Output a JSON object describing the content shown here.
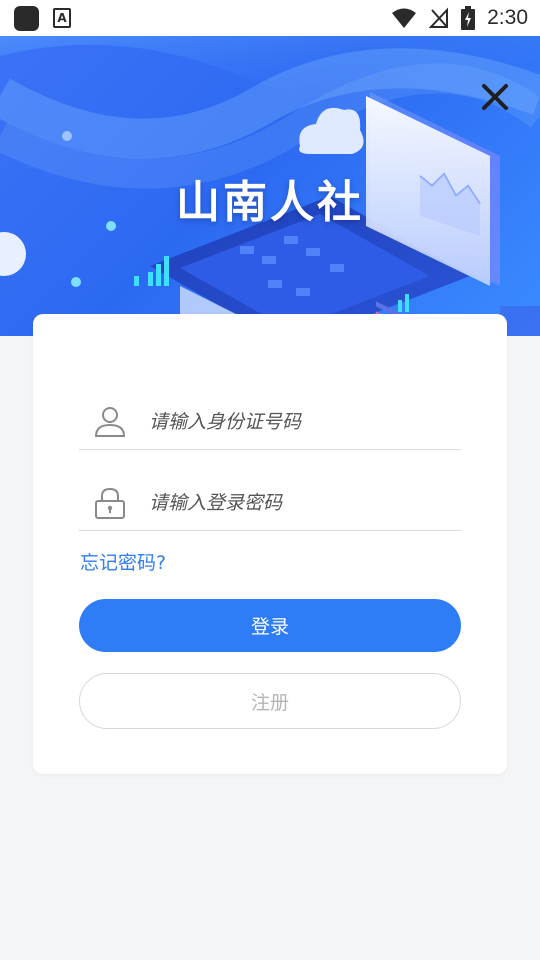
{
  "status_bar": {
    "time": "2:30",
    "icons": [
      "app-icon",
      "a-text-icon",
      "wifi-icon",
      "no-signal-icon",
      "battery-charging-icon"
    ]
  },
  "hero": {
    "title": "山南人社",
    "close_icon": "close-icon"
  },
  "form": {
    "id_field": {
      "placeholder": "请输入身份证号码",
      "value": "",
      "icon": "user-icon"
    },
    "password_field": {
      "placeholder": "请输入登录密码",
      "value": "",
      "icon": "lock-icon"
    },
    "forgot_label": "忘记密码?",
    "login_label": "登录",
    "register_label": "注册"
  },
  "colors": {
    "primary": "#2f7df6",
    "hero": "#3b73f6",
    "link": "#2f7df0",
    "background": "#f4f5f7"
  }
}
